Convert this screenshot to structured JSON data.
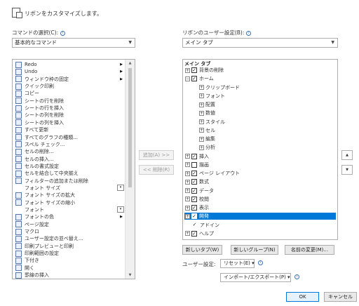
{
  "header": {
    "title": "リボンをカスタマイズします。"
  },
  "left": {
    "label": "コマンドの選択(C):",
    "combo_value": "基本的なコマンド",
    "commands": [
      {
        "label": "Redo",
        "icon": "redo-icon",
        "submenu": true
      },
      {
        "label": "Undo",
        "icon": "undo-icon",
        "submenu": true
      },
      {
        "label": "ウィンドウ枠の固定",
        "icon": "freeze-panes-icon",
        "submenu": true
      },
      {
        "label": "クイック印刷",
        "icon": "quick-print-icon"
      },
      {
        "label": "コピー",
        "icon": "copy-icon"
      },
      {
        "label": "シートの行を削除",
        "icon": "delete-row-icon"
      },
      {
        "label": "シートの行を挿入",
        "icon": "insert-row-icon"
      },
      {
        "label": "シートの列を削除",
        "icon": "delete-column-icon"
      },
      {
        "label": "シートの列を挿入",
        "icon": "insert-column-icon"
      },
      {
        "label": "すべて更新",
        "icon": "refresh-all-icon"
      },
      {
        "label": "すべてのグラフの種類...",
        "icon": "chart-types-icon"
      },
      {
        "label": "スペル チェック...",
        "icon": "spelling-icon"
      },
      {
        "label": "セルの削除...",
        "icon": "delete-cells-icon"
      },
      {
        "label": "セルの挿入...",
        "icon": "insert-cells-icon"
      },
      {
        "label": "セルの書式設定",
        "icon": "format-cells-icon"
      },
      {
        "label": "セルを結合して中央揃え",
        "icon": "merge-center-icon"
      },
      {
        "label": "フィルターの追加または削除",
        "icon": "filter-icon"
      },
      {
        "label": "フォント サイズ",
        "icon": "blank",
        "dropdown": true
      },
      {
        "label": "フォント サイズの拡大",
        "icon": "font-grow-icon"
      },
      {
        "label": "フォント サイズの縮小",
        "icon": "font-shrink-icon"
      },
      {
        "label": "フォント",
        "icon": "blank",
        "dropdown": true
      },
      {
        "label": "フォントの色",
        "icon": "font-color-icon",
        "submenu": true
      },
      {
        "label": "ページ設定",
        "icon": "page-setup-icon"
      },
      {
        "label": "マクロ",
        "icon": "macro-icon"
      },
      {
        "label": "ユーザー設定の並べ替え...",
        "icon": "custom-sort-icon"
      },
      {
        "label": "印刷プレビューと印刷",
        "icon": "print-preview-icon"
      },
      {
        "label": "印刷範囲の設定",
        "icon": "print-area-icon"
      },
      {
        "label": "下付き",
        "icon": "subscript-icon"
      },
      {
        "label": "開く",
        "icon": "open-icon"
      },
      {
        "label": "罫線の挿入",
        "icon": "border-icon"
      }
    ]
  },
  "middle": {
    "add_label": "追加(A) >>",
    "remove_label": "<< 削除(R)"
  },
  "right": {
    "label": "リボンのユーザー設定(B):",
    "combo_value": "メイン タブ",
    "tree_header": "メイン タブ",
    "tree": [
      {
        "label": "背景の削除",
        "level": 0,
        "expander": "+",
        "check": "checked"
      },
      {
        "label": "ホーム",
        "level": 0,
        "expander": "−",
        "check": "checked"
      },
      {
        "label": "クリップボード",
        "level": 1,
        "expander": "+",
        "check": "none"
      },
      {
        "label": "フォント",
        "level": 1,
        "expander": "+",
        "check": "none"
      },
      {
        "label": "配置",
        "level": 1,
        "expander": "+",
        "check": "none"
      },
      {
        "label": "数値",
        "level": 1,
        "expander": "+",
        "check": "none"
      },
      {
        "label": "スタイル",
        "level": 1,
        "expander": "+",
        "check": "none"
      },
      {
        "label": "セル",
        "level": 1,
        "expander": "+",
        "check": "none"
      },
      {
        "label": "編集",
        "level": 1,
        "expander": "+",
        "check": "none"
      },
      {
        "label": "分析",
        "level": 1,
        "expander": "+",
        "check": "none"
      },
      {
        "label": "挿入",
        "level": 0,
        "expander": "+",
        "check": "checked"
      },
      {
        "label": "描画",
        "level": 0,
        "expander": "+",
        "check": "unchecked"
      },
      {
        "label": "ページ レイアウト",
        "level": 0,
        "expander": "+",
        "check": "checked"
      },
      {
        "label": "数式",
        "level": 0,
        "expander": "+",
        "check": "checked"
      },
      {
        "label": "データ",
        "level": 0,
        "expander": "+",
        "check": "checked"
      },
      {
        "label": "校閲",
        "level": 0,
        "expander": "+",
        "check": "checked"
      },
      {
        "label": "表示",
        "level": 0,
        "expander": "+",
        "check": "checked"
      },
      {
        "label": "開発",
        "level": 0,
        "expander": "+",
        "check": "checked",
        "selected": true
      },
      {
        "label": "アドイン",
        "level": 0,
        "expander": "",
        "check": "plaincheck"
      },
      {
        "label": "ヘルプ",
        "level": 0,
        "expander": "+",
        "check": "checked"
      }
    ],
    "new_tab": "新しいタブ(W)",
    "new_group": "新しいグループ(N)",
    "rename": "名前の変更(M)...",
    "user_settings_label": "ユーザー設定:",
    "reset": "リセット(E) ▾",
    "import_export": "インポート/エクスポート(P) ▾"
  },
  "footer": {
    "ok": "OK",
    "cancel": "キャンセル"
  },
  "colors": {
    "selection": "#0078d7",
    "ok_border": "#0078d7"
  }
}
